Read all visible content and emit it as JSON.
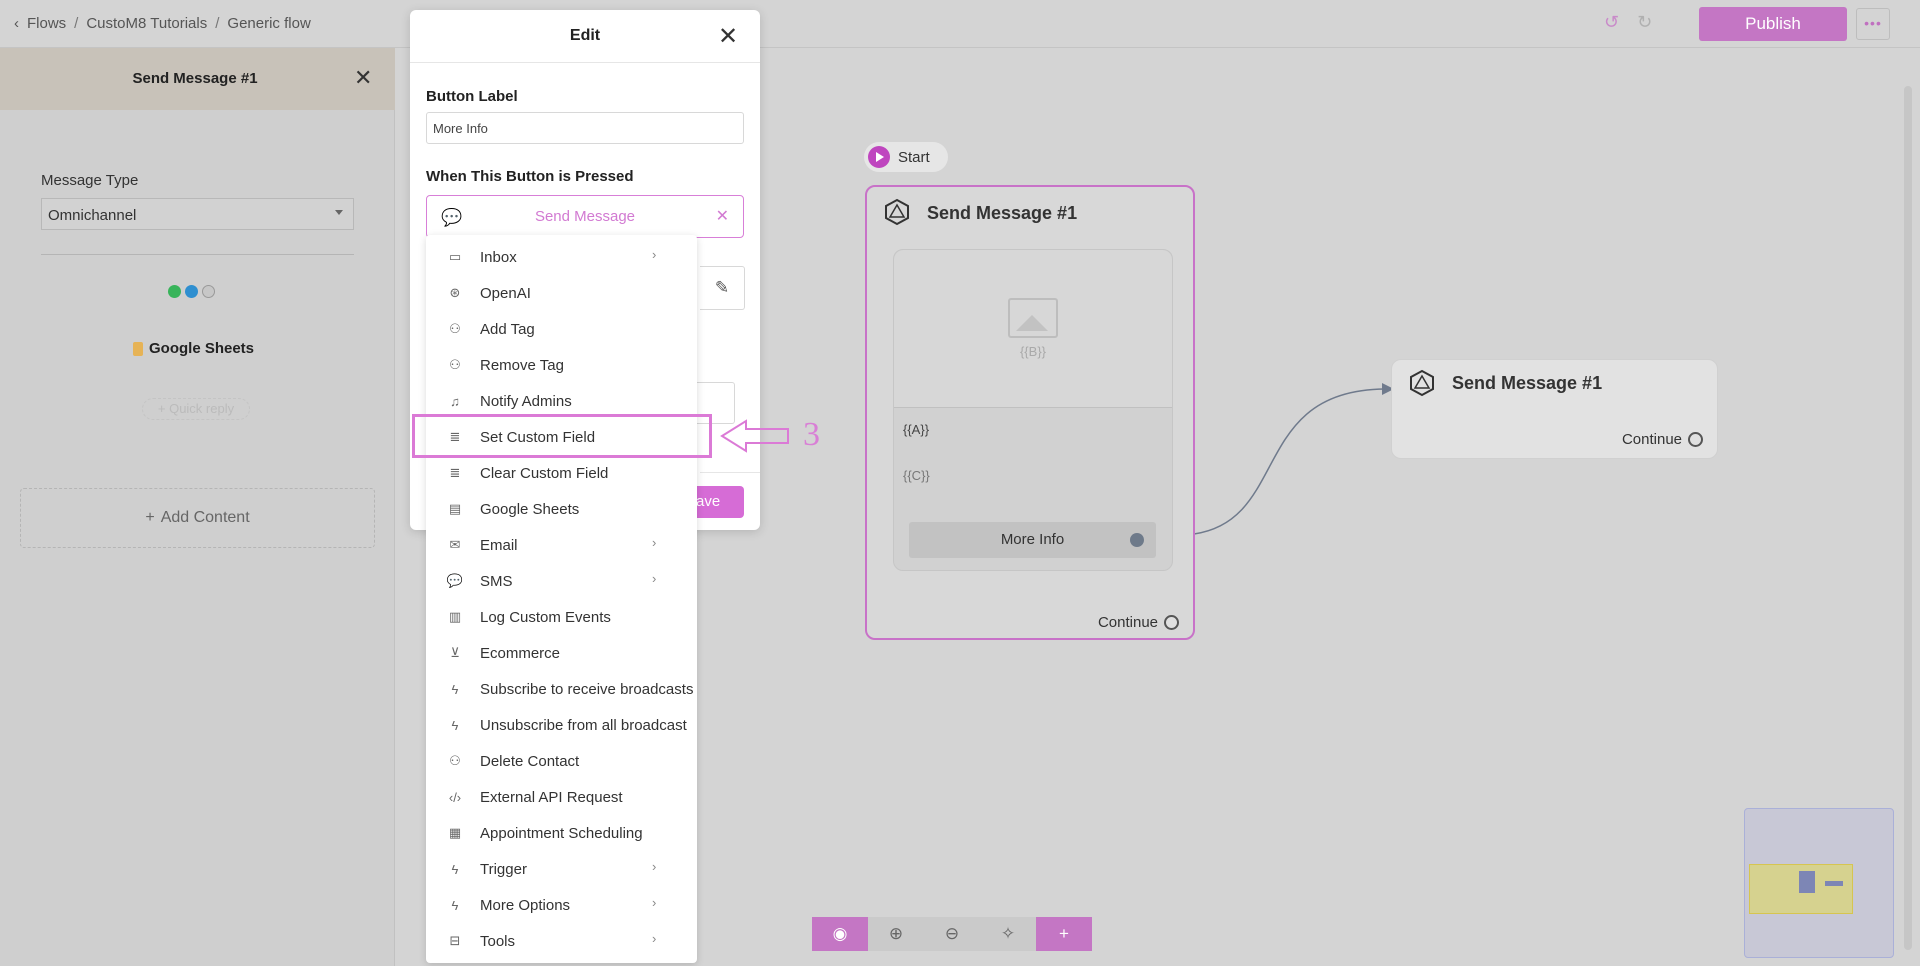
{
  "breadcrumb": {
    "items": [
      "Flows",
      "CustoM8 Tutorials",
      "Generic flow"
    ]
  },
  "toolbar": {
    "publish_label": "Publish",
    "more_label": "•••"
  },
  "left_panel": {
    "title": "Send Message #1",
    "message_type_label": "Message Type",
    "message_type_value": "Omnichannel",
    "google_sheets_label": "Google Sheets",
    "quick_reply_label": "+ Quick reply",
    "add_content_label": "Add Content"
  },
  "canvas": {
    "start_label": "Start",
    "node1": {
      "title": "Send Message #1",
      "image_var": "{{B}}",
      "text_var_a": "{{A}}",
      "text_var_c": "{{C}}",
      "button_label": "More Info",
      "continue_label": "Continue"
    },
    "node2": {
      "title": "Send Message #1",
      "continue_label": "Continue"
    }
  },
  "modal": {
    "title": "Edit",
    "button_label_heading": "Button Label",
    "button_label_value": "More Info",
    "when_pressed_heading": "When This Button is Pressed",
    "selected_action": "Send Message",
    "save_label": "ave"
  },
  "menu": {
    "items": [
      {
        "label": "Inbox",
        "icon": "inbox-icon",
        "has_submenu": true
      },
      {
        "label": "OpenAI",
        "icon": "openai-icon",
        "has_submenu": false
      },
      {
        "label": "Add Tag",
        "icon": "add-tag-icon",
        "has_submenu": false
      },
      {
        "label": "Remove Tag",
        "icon": "remove-tag-icon",
        "has_submenu": false
      },
      {
        "label": "Notify Admins",
        "icon": "bell-icon",
        "has_submenu": false
      },
      {
        "label": "Set Custom Field",
        "icon": "database-icon",
        "has_submenu": false
      },
      {
        "label": "Clear Custom Field",
        "icon": "database-icon",
        "has_submenu": false
      },
      {
        "label": "Google Sheets",
        "icon": "sheet-icon",
        "has_submenu": false
      },
      {
        "label": "Email",
        "icon": "mail-icon",
        "has_submenu": true
      },
      {
        "label": "SMS",
        "icon": "sms-icon",
        "has_submenu": true
      },
      {
        "label": "Log Custom Events",
        "icon": "chart-icon",
        "has_submenu": false
      },
      {
        "label": "Ecommerce",
        "icon": "cart-icon",
        "has_submenu": false
      },
      {
        "label": "Subscribe to receive broadcasts",
        "icon": "bolt-icon",
        "has_submenu": false
      },
      {
        "label": "Unsubscribe from all broadcast",
        "icon": "bolt-icon",
        "has_submenu": false
      },
      {
        "label": "Delete Contact",
        "icon": "delete-contact-icon",
        "has_submenu": false
      },
      {
        "label": "External API Request",
        "icon": "code-icon",
        "has_submenu": false
      },
      {
        "label": "Appointment Scheduling",
        "icon": "calendar-icon",
        "has_submenu": false
      },
      {
        "label": "Trigger",
        "icon": "bolt-icon",
        "has_submenu": true
      },
      {
        "label": "More Options",
        "icon": "bolt-icon",
        "has_submenu": true
      },
      {
        "label": "Tools",
        "icon": "toolbox-icon",
        "has_submenu": true
      }
    ]
  },
  "annotation": {
    "number": "3"
  },
  "colors": {
    "accent": "#c476c4",
    "highlight": "#db7ad6"
  }
}
